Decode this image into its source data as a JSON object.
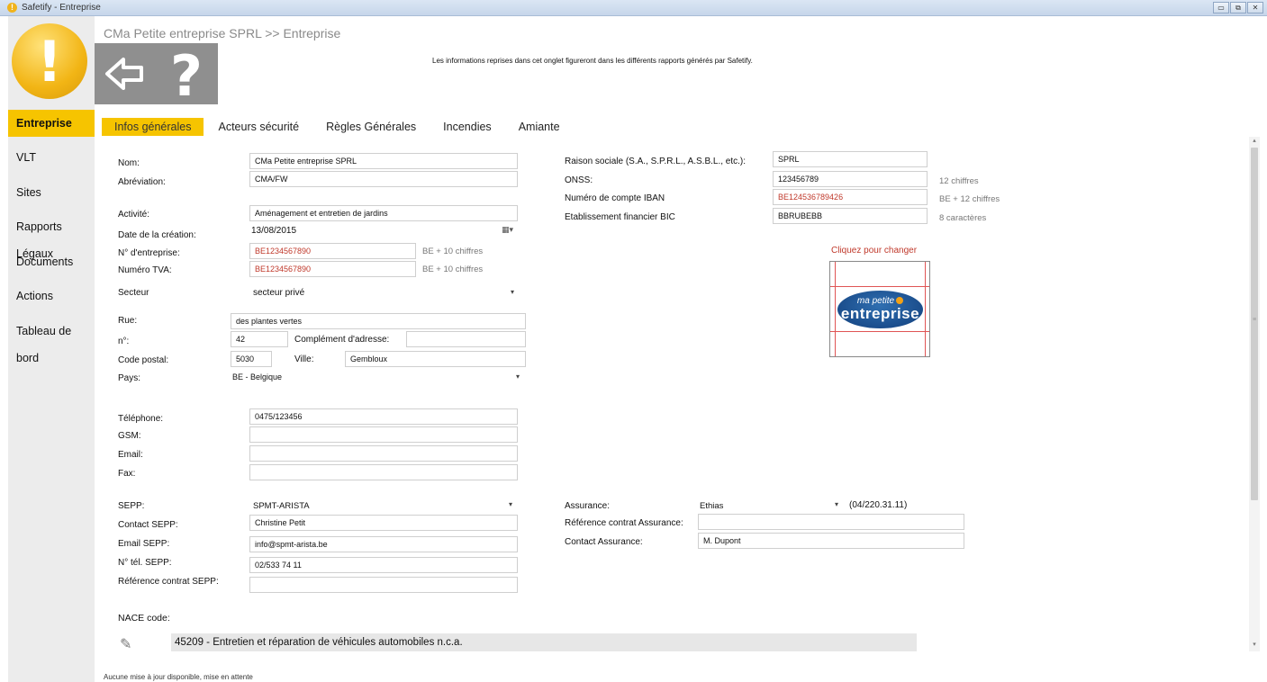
{
  "window": {
    "title": "Safetify - Entreprise",
    "controls": [
      "▭",
      "⧉",
      "✕"
    ]
  },
  "sidebar": {
    "logo_glyph": "!",
    "items": [
      {
        "label": "Entreprise",
        "active": true
      },
      {
        "label": "VLT"
      },
      {
        "label": "Sites"
      },
      {
        "label": "Rapports Légaux"
      },
      {
        "label": "Documents"
      },
      {
        "label": "Actions"
      },
      {
        "label": "Tableau de bord"
      }
    ]
  },
  "header": {
    "breadcrumb": "CMa Petite entreprise SPRL >> Entreprise",
    "info": "Les informations reprises dans cet onglet figureront dans les différents rapports générés par Safetify.",
    "back_icon": "back-arrow-icon",
    "help_icon": "help-question-icon"
  },
  "tabs": [
    {
      "label": "Infos générales",
      "active": true
    },
    {
      "label": "Acteurs sécurité"
    },
    {
      "label": "Règles Générales"
    },
    {
      "label": "Incendies"
    },
    {
      "label": "Amiante"
    }
  ],
  "form": {
    "nom": {
      "label": "Nom:",
      "value": "CMa Petite entreprise SPRL"
    },
    "abreviation": {
      "label": "Abréviation:",
      "value": "CMA/FW"
    },
    "activite": {
      "label": "Activité:",
      "value": "Aménagement et entretien de jardins"
    },
    "date_creation": {
      "label": "Date de la création:",
      "value": "13/08/2015"
    },
    "num_entreprise": {
      "label": "N° d'entreprise:",
      "value": "BE1234567890",
      "hint": "BE + 10 chiffres"
    },
    "num_tva": {
      "label": "Numéro TVA:",
      "value": "BE1234567890",
      "hint": "BE + 10 chiffres"
    },
    "secteur": {
      "label": "Secteur",
      "value": "secteur privé"
    },
    "rue": {
      "label": "Rue:",
      "value": "des plantes vertes"
    },
    "numero": {
      "label": "n°:",
      "value": "42"
    },
    "complement": {
      "label": "Complément d'adresse:",
      "value": ""
    },
    "code_postal": {
      "label": "Code postal:",
      "value": "5030"
    },
    "ville": {
      "label": "Ville:",
      "value": "Gembloux"
    },
    "pays": {
      "label": "Pays:",
      "value": "BE - Belgique"
    },
    "telephone": {
      "label": "Téléphone:",
      "value": "0475/123456"
    },
    "gsm": {
      "label": "GSM:",
      "value": ""
    },
    "email": {
      "label": "Email:",
      "value": ""
    },
    "fax": {
      "label": "Fax:",
      "value": ""
    },
    "sepp": {
      "label": "SEPP:",
      "value": "SPMT-ARISTA"
    },
    "contact_sepp": {
      "label": "Contact SEPP:",
      "value": "Christine Petit"
    },
    "email_sepp": {
      "label": "Email SEPP:",
      "value": "info@spmt-arista.be"
    },
    "tel_sepp": {
      "label": "N° tél. SEPP:",
      "value": "02/533 74 11"
    },
    "ref_sepp": {
      "label": "Référence contrat SEPP:",
      "value": ""
    },
    "raison_sociale": {
      "label": "Raison sociale (S.A., S.P.R.L., A.S.B.L., etc.):",
      "value": "SPRL"
    },
    "onss": {
      "label": "ONSS:",
      "value": "123456789",
      "hint": "12 chiffres"
    },
    "iban": {
      "label": "Numéro de compte IBAN",
      "value": "BE124536789426",
      "hint": "BE + 12 chiffres"
    },
    "bic": {
      "label": "Etablissement financier BIC",
      "value": "BBRUBEBB",
      "hint": "8 caractères"
    },
    "logo": {
      "change_label": "Cliquez pour changer",
      "line1": "ma petite",
      "line2": "entreprise"
    },
    "assurance": {
      "label": "Assurance:",
      "value": "Ethias",
      "phone": "(04/220.31.11)"
    },
    "ref_assurance": {
      "label": "Référence contrat Assurance:",
      "value": ""
    },
    "contact_assurance": {
      "label": "Contact Assurance:",
      "value": "M. Dupont"
    },
    "nace": {
      "label": "NACE code:",
      "value": "45209 - Entretien et réparation de véhicules automobiles n.c.a."
    }
  },
  "status": "Aucune mise à jour disponible, mise en attente"
}
